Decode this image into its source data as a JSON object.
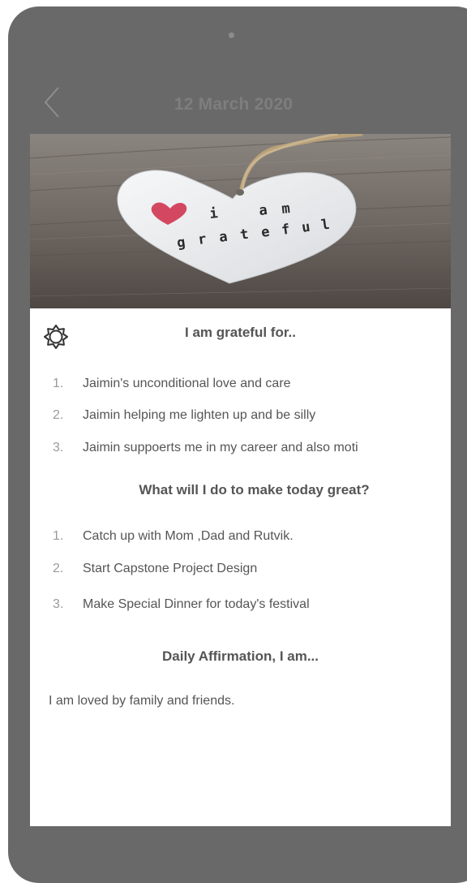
{
  "header": {
    "title": "12 March 2020",
    "back_icon": "chevron-left-icon"
  },
  "hero": {
    "image": "heart-gratitude-photo",
    "lettering": "i am grateful"
  },
  "settings_icon": "gear-icon",
  "grateful": {
    "title": "I am grateful for..",
    "items": [
      {
        "num": "1.",
        "text": "Jaimin's unconditional love and care"
      },
      {
        "num": "2.",
        "text": "Jaimin helping me lighten up and be silly"
      },
      {
        "num": "3.",
        "text": "Jaimin suppoerts me in my career and also moti"
      }
    ]
  },
  "today": {
    "title": "What will I do to make today great?",
    "items": [
      {
        "num": "1.",
        "text": "Catch up with Mom ,Dad and Rutvik."
      },
      {
        "num": "2.",
        "text": "Start Capstone Project Design"
      },
      {
        "num": "3.",
        "text": "Make Special Dinner for today's festival"
      }
    ]
  },
  "affirmation": {
    "title": "Daily Affirmation, I am...",
    "text": "I am loved by family and friends."
  },
  "colors": {
    "device": "#696969",
    "text": "#555555",
    "number": "#9a9a9a",
    "header_text": "#7e7e7e"
  }
}
